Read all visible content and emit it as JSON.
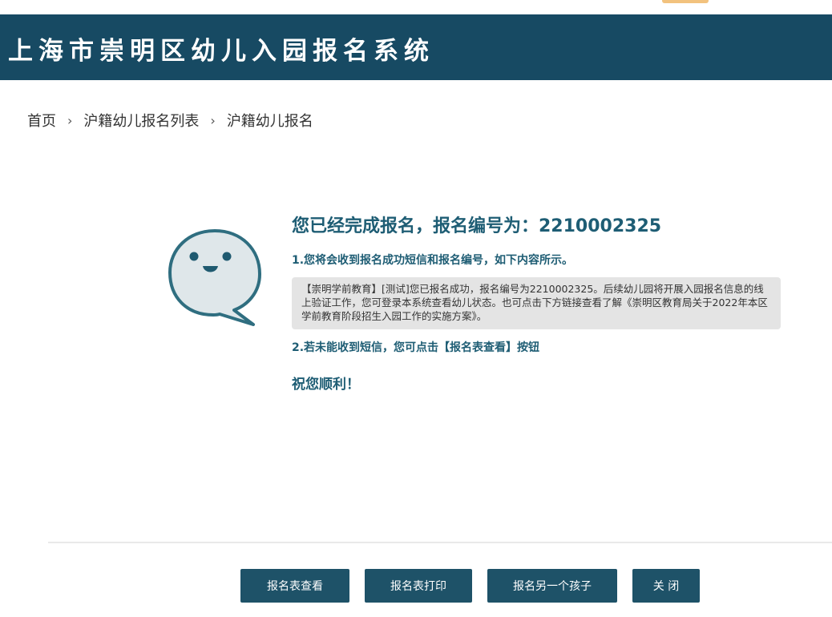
{
  "app": {
    "title": "上海市崇明区幼儿入园报名系统"
  },
  "breadcrumb": {
    "items": [
      "首页",
      "沪籍幼儿报名列表",
      "沪籍幼儿报名"
    ],
    "separator": "›"
  },
  "mascot": {
    "icon": "smiling-speech-bubble-icon"
  },
  "confirmation": {
    "title": "您已经完成报名，报名编号为：2210002325",
    "step1": "1.您将会收到报名成功短信和报名编号，如下内容所示。",
    "sms_text": "【崇明学前教育】[测试]您已报名成功，报名编号为2210002325。后续幼儿园将开展入园报名信息的线上验证工作，您可登录本系统查看幼儿状态。也可点击下方链接查看了解《崇明区教育局关于2022年本区学前教育阶段招生入园工作的实施方案》。",
    "step2": "2.若未能收到短信，您可点击【报名表查看】按钮",
    "wish": "祝您顺利！"
  },
  "actions": {
    "view_label": "报名表查看",
    "print_label": "报名表打印",
    "another_label": "报名另一个孩子",
    "close_label": "关 闭"
  },
  "colors": {
    "header_bg": "#174a63",
    "accent_text": "#1e5d74",
    "button_bg": "#1e5268",
    "sms_box_bg": "#e4e4e4"
  }
}
